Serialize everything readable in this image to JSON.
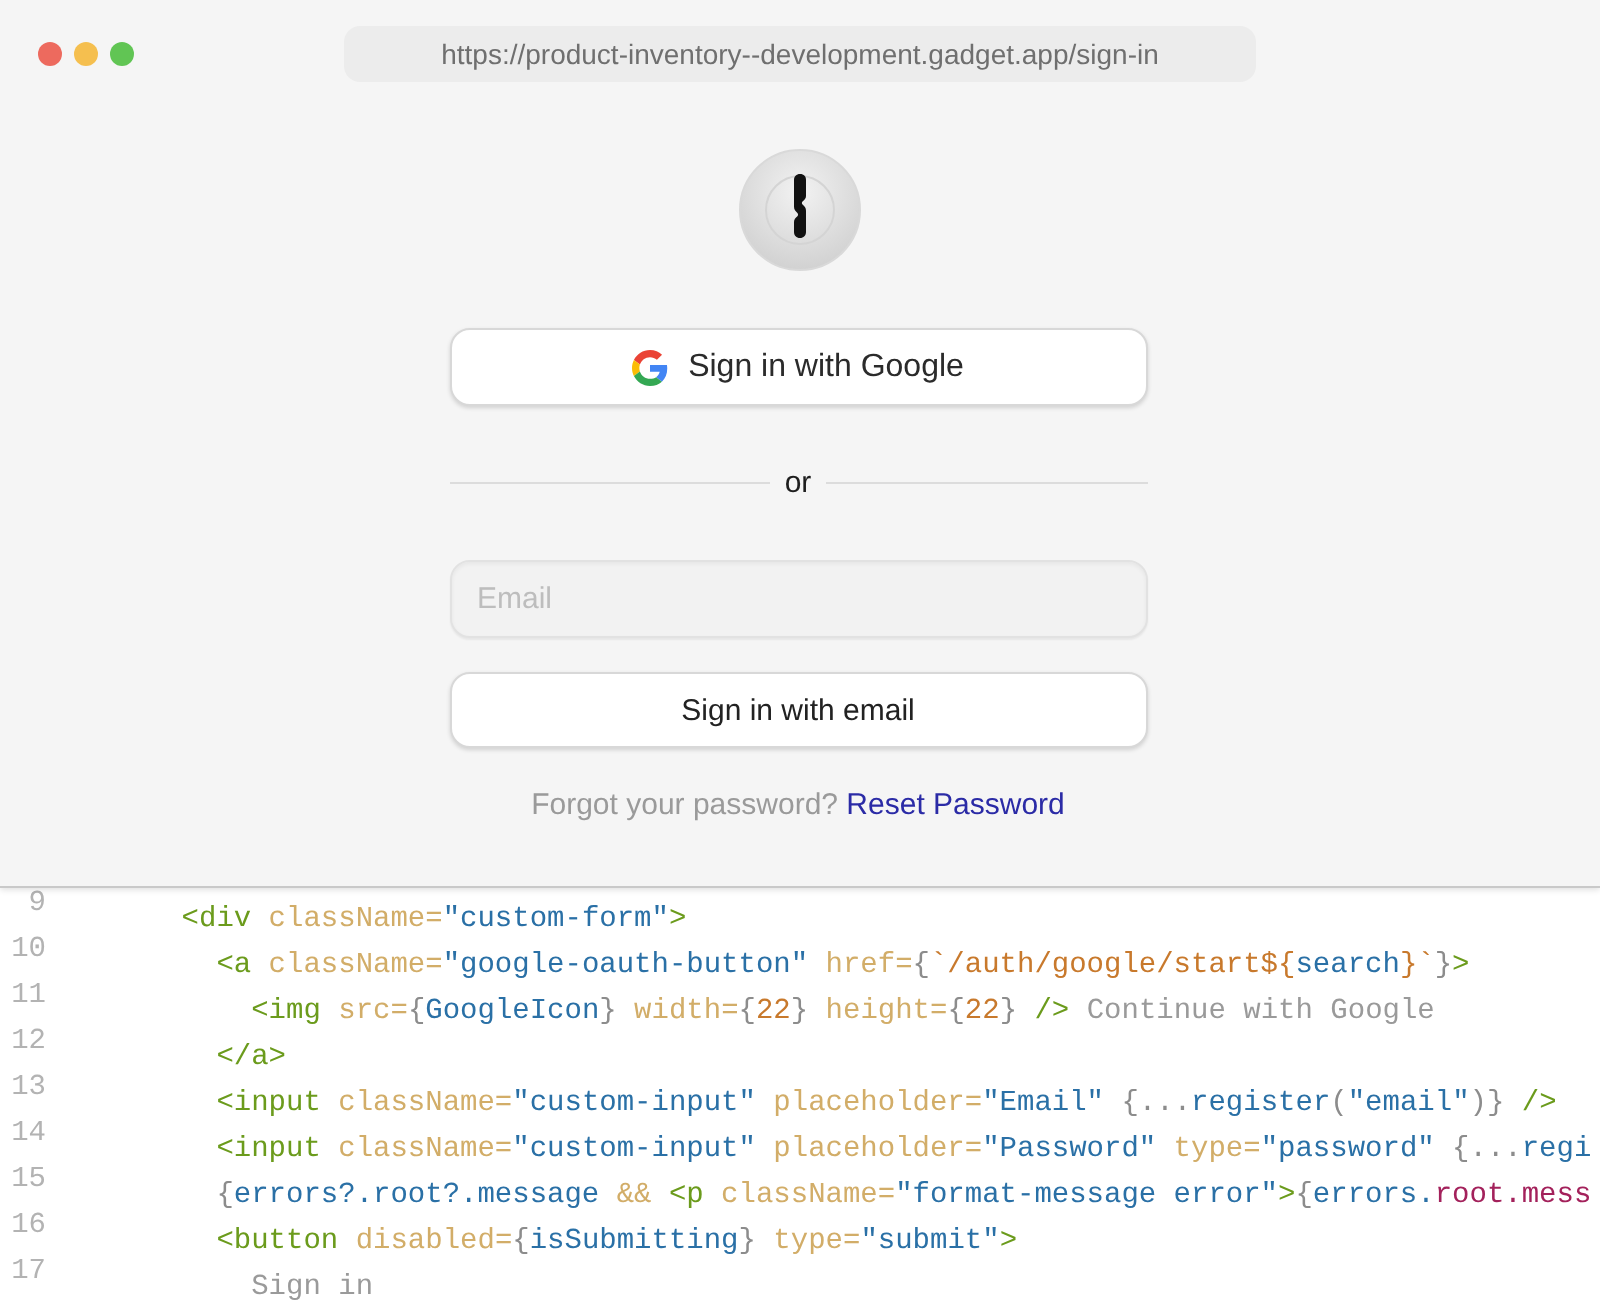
{
  "address_bar": {
    "url": "https://product-inventory--development.gadget.app/sign-in"
  },
  "sign_in": {
    "google_button": {
      "label": "Sign in with Google"
    },
    "divider": {
      "label": "or"
    },
    "email_field": {
      "placeholder": "Email"
    },
    "email_button": {
      "label": "Sign in with email"
    },
    "forgot": {
      "prompt": "Forgot your password?",
      "link": "Reset Password"
    }
  },
  "code_editor": {
    "lines": [
      {
        "number": "9",
        "tokens": [
          {
            "kind": "tag",
            "text": "<div"
          },
          {
            "kind": "attr",
            "text": " className="
          },
          {
            "kind": "string",
            "text": "\"custom-form\""
          },
          {
            "kind": "tag",
            "text": ">"
          }
        ],
        "children": [
          {
            "number": "10",
            "tokens": [
              {
                "kind": "tag",
                "text": "<a"
              },
              {
                "kind": "attr",
                "text": " className="
              },
              {
                "kind": "string",
                "text": "\"google-oauth-button\""
              },
              {
                "kind": "attr",
                "text": " href="
              },
              {
                "kind": "punct",
                "text": "{"
              },
              {
                "kind": "template",
                "text": "`/auth/google/start${"
              },
              {
                "kind": "ident",
                "text": "search"
              },
              {
                "kind": "template",
                "text": "}`"
              },
              {
                "kind": "punct",
                "text": "}"
              },
              {
                "kind": "tag",
                "text": ">"
              }
            ],
            "children": [
              {
                "number": "11",
                "tokens": [
                  {
                    "kind": "tag",
                    "text": "<img"
                  },
                  {
                    "kind": "attr",
                    "text": " src="
                  },
                  {
                    "kind": "punct",
                    "text": "{"
                  },
                  {
                    "kind": "ident",
                    "text": "GoogleIcon"
                  },
                  {
                    "kind": "punct",
                    "text": "}"
                  },
                  {
                    "kind": "attr",
                    "text": " width="
                  },
                  {
                    "kind": "punct",
                    "text": "{"
                  },
                  {
                    "kind": "number",
                    "text": "22"
                  },
                  {
                    "kind": "punct",
                    "text": "}"
                  },
                  {
                    "kind": "attr",
                    "text": " height="
                  },
                  {
                    "kind": "punct",
                    "text": "{"
                  },
                  {
                    "kind": "number",
                    "text": "22"
                  },
                  {
                    "kind": "punct",
                    "text": "}"
                  },
                  {
                    "kind": "tag",
                    "text": " />"
                  },
                  {
                    "kind": "text",
                    "text": " Continue with Google"
                  }
                ]
              }
            ]
          },
          {
            "number": "12",
            "tokens": [
              {
                "kind": "tag",
                "text": "</a>"
              }
            ]
          },
          {
            "number": "13",
            "tokens": [
              {
                "kind": "tag",
                "text": "<input"
              },
              {
                "kind": "attr",
                "text": " className="
              },
              {
                "kind": "string",
                "text": "\"custom-input\""
              },
              {
                "kind": "attr",
                "text": " placeholder="
              },
              {
                "kind": "string",
                "text": "\"Email\""
              },
              {
                "kind": "punct",
                "text": " {..."
              },
              {
                "kind": "ident",
                "text": "register"
              },
              {
                "kind": "punct",
                "text": "("
              },
              {
                "kind": "string",
                "text": "\"email\""
              },
              {
                "kind": "punct",
                "text": ")}"
              },
              {
                "kind": "tag",
                "text": " />"
              }
            ]
          },
          {
            "number": "14",
            "tokens": [
              {
                "kind": "tag",
                "text": "<input"
              },
              {
                "kind": "attr",
                "text": " className="
              },
              {
                "kind": "string",
                "text": "\"custom-input\""
              },
              {
                "kind": "attr",
                "text": " placeholder="
              },
              {
                "kind": "string",
                "text": "\"Password\""
              },
              {
                "kind": "attr",
                "text": " type="
              },
              {
                "kind": "string",
                "text": "\"password\""
              },
              {
                "kind": "punct",
                "text": " {..."
              },
              {
                "kind": "ident",
                "text": "regi"
              }
            ]
          },
          {
            "number": "15",
            "tokens": [
              {
                "kind": "punct",
                "text": "{"
              },
              {
                "kind": "ident",
                "text": "errors?.root?.message"
              },
              {
                "kind": "attr",
                "text": " &&"
              },
              {
                "kind": "tag",
                "text": " <p"
              },
              {
                "kind": "attr",
                "text": " className="
              },
              {
                "kind": "string",
                "text": "\"format-message error\""
              },
              {
                "kind": "tag",
                "text": ">"
              },
              {
                "kind": "punct",
                "text": "{"
              },
              {
                "kind": "ident",
                "text": "errors."
              },
              {
                "kind": "property",
                "text": "root.mess"
              }
            ]
          },
          {
            "number": "16",
            "tokens": [
              {
                "kind": "tag",
                "text": "<button"
              },
              {
                "kind": "attr",
                "text": " disabled="
              },
              {
                "kind": "punct",
                "text": "{"
              },
              {
                "kind": "ident",
                "text": "isSubmitting"
              },
              {
                "kind": "punct",
                "text": "}"
              },
              {
                "kind": "attr",
                "text": " type="
              },
              {
                "kind": "string",
                "text": "\"submit\""
              },
              {
                "kind": "tag",
                "text": ">"
              }
            ],
            "children": [
              {
                "number": "17",
                "tokens": [
                  {
                    "kind": "text",
                    "text": "Sign in"
                  }
                ]
              }
            ]
          }
        ]
      }
    ]
  }
}
